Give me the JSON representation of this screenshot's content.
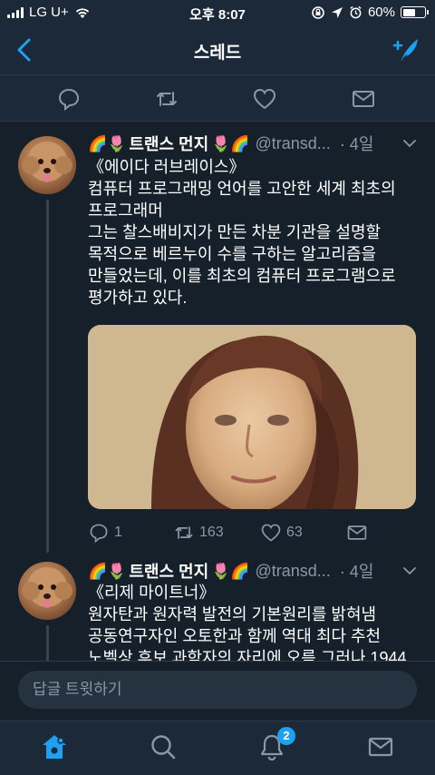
{
  "status_bar": {
    "carrier": "LG U+",
    "time": "오후 8:07",
    "battery": "60%",
    "battery_level": 0.6
  },
  "nav": {
    "title": "스레드",
    "back_icon": "chevron-left-icon",
    "compose_icon": "compose-tweet-icon"
  },
  "colors": {
    "background": "#15202b",
    "bar": "#1c2938",
    "accent": "#1da1f2",
    "muted": "#8899a6"
  },
  "tweets": [
    {
      "emoji_left": "🌈🌷",
      "name": "트랜스 먼지",
      "emoji_right": "🌷🌈",
      "handle": "@transd...",
      "time": "· 4일",
      "body": "《에이다 러브레이스》\n컴퓨터 프로그래밍 언어를 고안한 세계 최초의\n프로그래머\n그는 찰스배비지가 만든 차분 기관을 설명할\n목적으로 베르누이 수를 구하는 알고리즘을\n만들었는데, 이를 최초의 컴퓨터 프로그램으로\n평가하고 있다.",
      "replies": "1",
      "retweets": "163",
      "likes": "63"
    },
    {
      "emoji_left": "🌈🌷",
      "name": "트랜스 먼지",
      "emoji_right": "🌷🌈",
      "handle": "@transd...",
      "time": "· 4일",
      "body": "《리제 마이트너》\n원자탄과 원자력 발전의 기본원리를 밝혀냄\n공동연구자인 오토한과 함께 역대 최다 추천\n노벨상 후보 과학자의 자리에 오름 그러나 1944"
    }
  ],
  "reply_bar": {
    "placeholder": "답글 트윗하기"
  },
  "tab_bar": {
    "notifications_badge": "2"
  }
}
